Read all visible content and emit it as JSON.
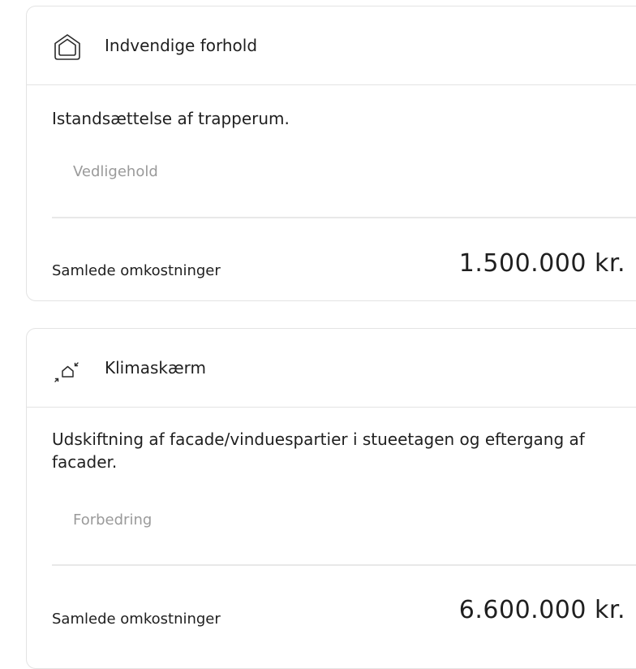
{
  "cards": [
    {
      "icon": "house-outline-icon",
      "title": "Indvendige forhold",
      "description": "Istandsættelse af trapperum.",
      "tag": "Vedligehold",
      "total_label": "Samlede omkostninger",
      "total_value": "1.500.000 kr."
    },
    {
      "icon": "house-climate-icon",
      "title": "Klimaskærm",
      "description": "Udskiftning af facade/vinduespartier i stueetagen og eftergang af facader.",
      "tag": "Forbedring",
      "total_label": "Samlede omkostninger",
      "total_value": "6.600.000 kr."
    }
  ]
}
